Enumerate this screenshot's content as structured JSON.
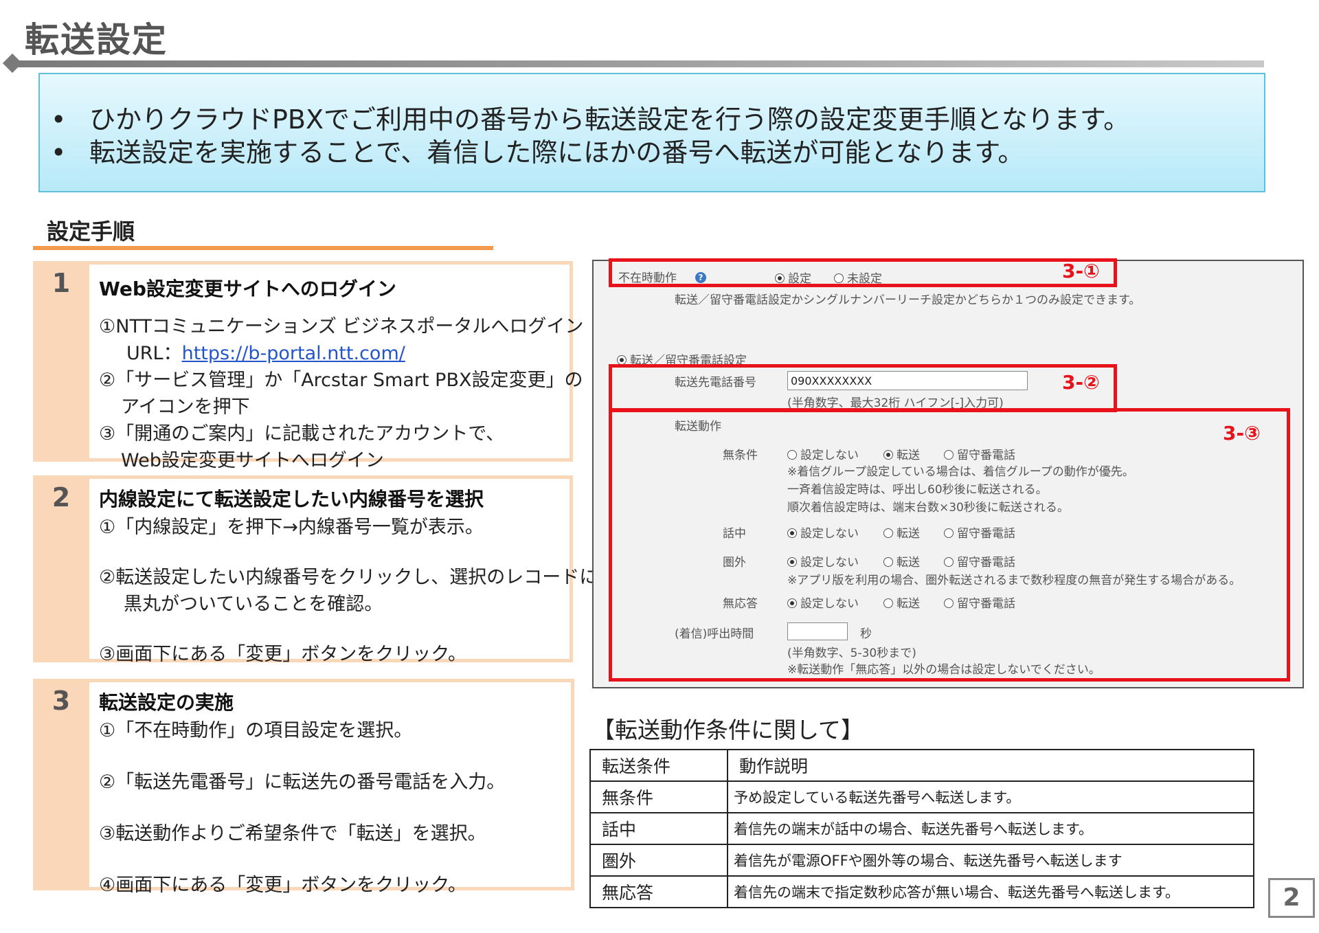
{
  "title": "転送設定",
  "intro": [
    "ひかりクラウドPBXでご利用中の番号から転送設定を行う際の設定変更手順となります。",
    "転送設定を実施することで、着信した際にほかの番号へ転送が可能となります。"
  ],
  "bullet": "•",
  "procedure_title": "設定手順",
  "steps": [
    {
      "num": "1",
      "heading": "Web設定変更サイトへのログイン",
      "l1": "①NTTコミュニケーションズ ビジネスポータルへログイン",
      "url_label": "URL：",
      "url": "https://b-portal.ntt.com/",
      "l3": "②「サービス管理」か「Arcstar Smart PBX設定変更」の",
      "l4": "アイコンを押下",
      "l5": "③「開通のご案内」に記載されたアカウントで、",
      "l6": "Web設定変更サイトへログイン"
    },
    {
      "num": "2",
      "heading": "内線設定にて転送設定したい内線番号を選択",
      "l1": "①「内線設定」を押下→内線番号一覧が表示。",
      "l2": "②転送設定したい内線番号をクリックし、選択のレコードに",
      "l3": "黒丸がついていることを確認。",
      "l4": "③画面下にある「変更」ボタンをクリック。"
    },
    {
      "num": "3",
      "heading": "転送設定の実施",
      "l1": "①「不在時動作」の項目設定を選択。",
      "l2": "②「転送先電番号」に転送先の番号電話を入力。",
      "l3": "③転送動作よりご希望条件で「転送」を選択。",
      "l4": "④画面下にある「変更」ボタンをクリック。"
    }
  ],
  "panel": {
    "absent_label": "不在時動作",
    "opt_set": "設定",
    "opt_unset": "未設定",
    "note_top": "転送／留守番電話設定かシングルナンバーリーチ設定かどちらか１つのみ設定できます。",
    "section": "転送／留守番電話設定",
    "dest_label": "転送先電話番号",
    "dest_value": "090XXXXXXXX",
    "dest_note": "(半角数字、最大32桁 ハイフン[-]入力可)",
    "action_label": "転送動作",
    "rows": [
      {
        "label": "無条件",
        "opts": [
          "設定しない",
          "転送",
          "留守番電話"
        ],
        "selected": 1,
        "notes": [
          "※着信グループ設定している場合は、着信グループの動作が優先。",
          "一斉着信設定時は、呼出し60秒後に転送される。",
          "順次着信設定時は、端末台数×30秒後に転送される。"
        ]
      },
      {
        "label": "話中",
        "opts": [
          "設定しない",
          "転送",
          "留守番電話"
        ],
        "selected": 0,
        "notes": []
      },
      {
        "label": "圏外",
        "opts": [
          "設定しない",
          "転送",
          "留守番電話"
        ],
        "selected": 0,
        "notes": [
          "※アプリ版を利用の場合、圏外転送されるまで数秒程度の無音が発生する場合がある。"
        ]
      },
      {
        "label": "無応答",
        "opts": [
          "設定しない",
          "転送",
          "留守番電話"
        ],
        "selected": 0,
        "notes": []
      }
    ],
    "ring_label": "(着信)呼出時間",
    "ring_unit": "秒",
    "ring_note1": "(半角数字、5-30秒まで)",
    "ring_note2": "※転送動作「無応答」以外の場合は設定しないでください。",
    "tag1": "3-①",
    "tag2": "3-②",
    "tag3": "3-③",
    "red_color": "#e8121a"
  },
  "conditions_title": "【転送動作条件に関して】",
  "conditions": {
    "headers": [
      "転送条件",
      "動作説明"
    ],
    "rows": [
      [
        "無条件",
        "予め設定している転送先番号へ転送します。"
      ],
      [
        "話中",
        "着信先の端末が話中の場合、転送先番号へ転送します。"
      ],
      [
        "圏外",
        "着信先が電源OFFや圏外等の場合、転送先番号へ転送します"
      ],
      [
        "無応答",
        "着信先の端末で指定数秒応答が無い場合、転送先番号へ転送します。"
      ]
    ]
  },
  "page_number": "2"
}
